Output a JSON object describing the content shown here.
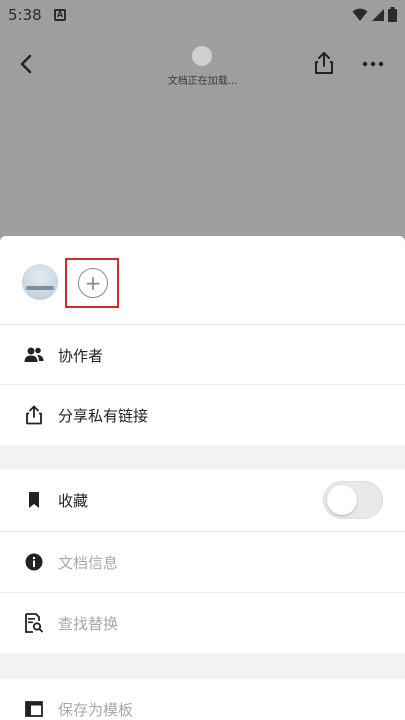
{
  "status_bar": {
    "time": "5:38",
    "notification_glyph": "A",
    "icons": [
      "wifi-icon",
      "signal-icon",
      "battery-icon"
    ]
  },
  "app_bar": {
    "loading_text": "文档正在加载...",
    "icons": [
      "back-arrow-icon",
      "share-icon",
      "more-icon"
    ]
  },
  "sheet": {
    "collaborators": {
      "add_button_glyph": "+"
    },
    "items": [
      {
        "label": "协作者",
        "icon": "collaborators-icon",
        "enabled": true
      },
      {
        "label": "分享私有链接",
        "icon": "share-link-icon",
        "enabled": true
      },
      {
        "label": "收藏",
        "icon": "bookmark-icon",
        "enabled": true,
        "toggle": false
      },
      {
        "label": "文档信息",
        "icon": "info-icon",
        "enabled": false
      },
      {
        "label": "查找替换",
        "icon": "find-replace-icon",
        "enabled": false
      },
      {
        "label": "保存为模板",
        "icon": "template-icon",
        "enabled": false
      }
    ]
  },
  "colors": {
    "overlay_gray": "#9e9e9e",
    "highlight_red": "#d02b2b",
    "disabled_text": "#a8a8a8"
  }
}
